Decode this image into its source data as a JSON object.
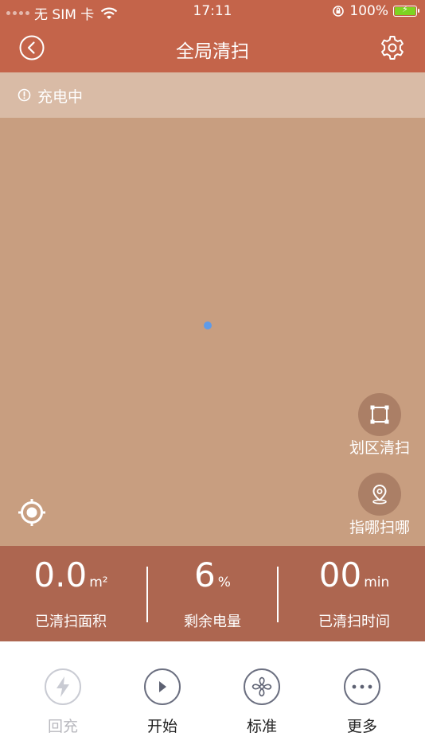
{
  "status_bar": {
    "carrier": "无 SIM 卡",
    "time": "17:11",
    "battery_percent": "100%",
    "battery_level": 1.0
  },
  "navbar": {
    "title": "全局清扫"
  },
  "banner": {
    "text": "充电中"
  },
  "map": {
    "zone_clean_label": "划区清扫",
    "spot_clean_label": "指哪扫哪"
  },
  "stats": {
    "area": {
      "value": "0.0",
      "unit": "m²",
      "label": "已清扫面积"
    },
    "battery": {
      "value": "6",
      "unit": "%",
      "label": "剩余电量"
    },
    "time": {
      "value": "00",
      "unit": "min",
      "label": "已清扫时间"
    }
  },
  "actions": {
    "recharge_label": "回充",
    "start_label": "开始",
    "mode_label": "标准",
    "more_label": "更多"
  },
  "colors": {
    "header": "#c4644a",
    "banner": "#d9bba6",
    "map": "#c89e80",
    "stats": "#ad6650",
    "robot": "#5f9be8"
  }
}
